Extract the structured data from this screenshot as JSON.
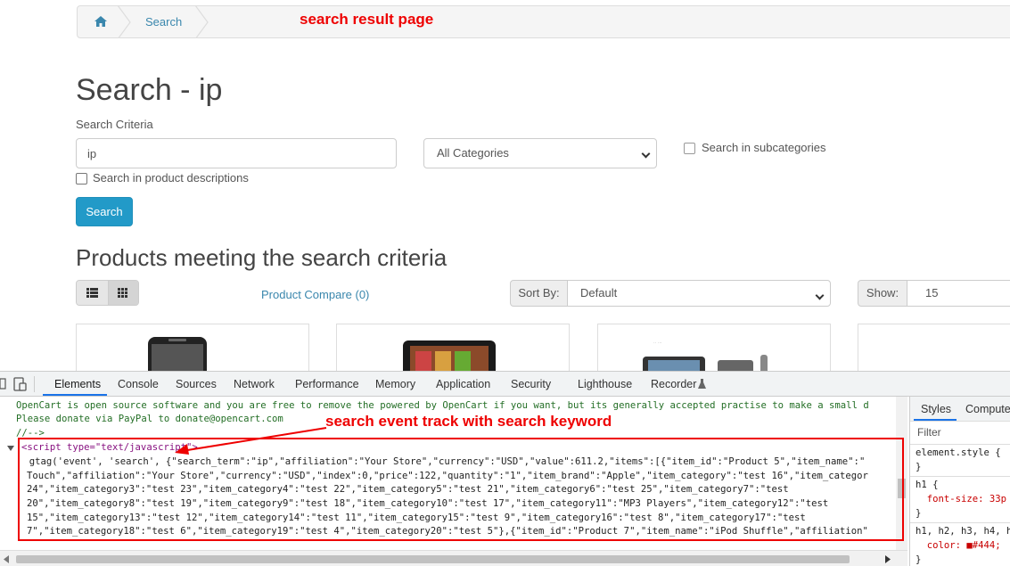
{
  "breadcrumb": {
    "home_icon": "home-icon",
    "current": "Search"
  },
  "annotations": {
    "top": "search result page",
    "devtools": "search event track with search keyword"
  },
  "page": {
    "title": "Search - ip",
    "criteria_label": "Search Criteria",
    "search_value": "ip",
    "category_value": "All Categories",
    "subcategories_label": "Search in subcategories",
    "descriptions_label": "Search in product descriptions",
    "search_button": "Search",
    "products_heading": "Products meeting the search criteria",
    "compare_link": "Product Compare (0)",
    "sort_label": "Sort By:",
    "sort_value": "Default",
    "show_label": "Show:",
    "show_value": "15"
  },
  "devtools": {
    "tabs": [
      "Elements",
      "Console",
      "Sources",
      "Network",
      "Performance",
      "Memory",
      "Application",
      "Security",
      "Lighthouse",
      "Recorder"
    ],
    "code_lines": [
      "OpenCart is open source software and you are free to remove the powered by OpenCart if you want, but its generally accepted practise to make a small d",
      "Please donate via PayPal to donate@opencart.com",
      "//-->",
      "<script type=\"text/javascript\">",
      "  gtag('event', 'search', {\"search_term\":\"ip\",\"affiliation\":\"Your Store\",\"currency\":\"USD\",\"value\":611.2,\"items\":[{\"item_id\":\"Product 5\",\"item_name\":\"",
      "Touch\",\"affiliation\":\"Your Store\",\"currency\":\"USD\",\"index\":0,\"price\":122,\"quantity\":\"1\",\"item_brand\":\"Apple\",\"item_category\":\"test 16\",\"item_categor",
      "24\",\"item_category3\":\"test 23\",\"item_category4\":\"test 22\",\"item_category5\":\"test 21\",\"item_category6\":\"test 25\",\"item_category7\":\"test",
      "20\",\"item_category8\":\"test 19\",\"item_category9\":\"test 18\",\"item_category10\":\"test 17\",\"item_category11\":\"MP3 Players\",\"item_category12\":\"test",
      "15\",\"item_category13\":\"test 12\",\"item_category14\":\"test 11\",\"item_category15\":\"test 9\",\"item_category16\":\"test 8\",\"item_category17\":\"test",
      "7\",\"item_category18\":\"test 6\",\"item_category19\":\"test 4\",\"item_category20\":\"test 5\"},{\"item_id\":\"Product 7\",\"item_name\":\"iPod Shuffle\",\"affiliation\""
    ],
    "styles_tabs": [
      "Styles",
      "Computed"
    ],
    "filter": "Filter",
    "styles_lines": [
      "element.style {",
      "}",
      "h1 {",
      "  font-size: 33p",
      "}",
      "h1, h2, h3, h4, h",
      "  color: ■#444;",
      "}"
    ]
  }
}
